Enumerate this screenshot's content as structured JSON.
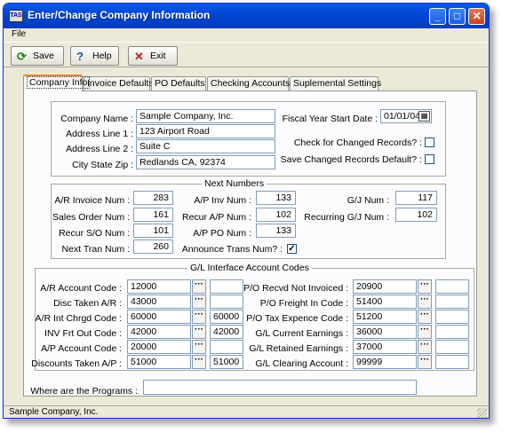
{
  "window": {
    "title": "Enter/Change Company Information",
    "app_icon_text": "TAS"
  },
  "title_buttons": {
    "minimize": "_",
    "maximize": "□",
    "close": "✕"
  },
  "menu": {
    "file": "File"
  },
  "toolbar": {
    "save": "Save",
    "help": "Help",
    "exit": "Exit"
  },
  "tabs": [
    "Company Info",
    "Invoice Defaults",
    "PO Defaults",
    "Checking Accounts",
    "Suplemental Settings"
  ],
  "company": {
    "name_label": "Company Name :",
    "name": "Sample Company, Inc.",
    "addr1_label": "Address Line 1 :",
    "addr1": "123 Airport Road",
    "addr2_label": "Address Line 2 :",
    "addr2": "Suite C",
    "csz_label": "City State Zip :",
    "csz": "Redlands CA, 92374",
    "fiscal_label": "Fiscal Year Start Date :",
    "fiscal": "01/01/04",
    "check_changed_label": "Check for Changed Records? :",
    "save_changed_label": "Save Changed Records Default? :"
  },
  "next_numbers": {
    "title": "Next Numbers",
    "ar_invoice_label": "A/R Invoice Num :",
    "ar_invoice": "283",
    "sales_order_label": "Sales Order Num :",
    "sales_order": "161",
    "recur_so_label": "Recur S/O Num :",
    "recur_so": "101",
    "next_tran_label": "Next Tran Num :",
    "next_tran": "260",
    "ap_inv_label": "A/P Inv Num :",
    "ap_inv": "133",
    "recur_ap_label": "Recur A/P Num :",
    "recur_ap": "102",
    "ap_po_label": "A/P PO Num :",
    "ap_po": "133",
    "announce_label": "Announce Trans Num? :",
    "announce_checked": true,
    "gj_label": "G/J Num :",
    "gj": "117",
    "recurring_gj_label": "Recurring G/J Num :",
    "recurring_gj": "102"
  },
  "gl_codes": {
    "title": "G/L Interface Account Codes",
    "left": [
      {
        "label": "A/R Account Code :",
        "code": "12000",
        "extra": ""
      },
      {
        "label": "Disc Taken A/R :",
        "code": "43000",
        "extra": ""
      },
      {
        "label": "A/R Int Chrgd Code :",
        "code": "60000",
        "extra": "60000"
      },
      {
        "label": "INV Frt Out Code :",
        "code": "42000",
        "extra": "42000"
      },
      {
        "label": "A/P Account Code :",
        "code": "20000",
        "extra": ""
      },
      {
        "label": "Discounts Taken A/P :",
        "code": "51000",
        "extra": "51000"
      }
    ],
    "right": [
      {
        "label": "P/O Recvd Not Invoiced :",
        "code": "20900",
        "extra": ""
      },
      {
        "label": "P/O Freight In Code :",
        "code": "51400",
        "extra": ""
      },
      {
        "label": "P/O Tax Expence Code :",
        "code": "51200",
        "extra": ""
      },
      {
        "label": "G/L Current Earnings :",
        "code": "36000",
        "extra": ""
      },
      {
        "label": "G/L Retained Earnings :",
        "code": "37000",
        "extra": ""
      },
      {
        "label": "G/L Clearing Account :",
        "code": "99999",
        "extra": ""
      }
    ],
    "lookup_glyph": "···"
  },
  "programs": {
    "label": "Where are the Programs :",
    "value": ""
  },
  "status": {
    "text": "Sample Company, Inc."
  }
}
